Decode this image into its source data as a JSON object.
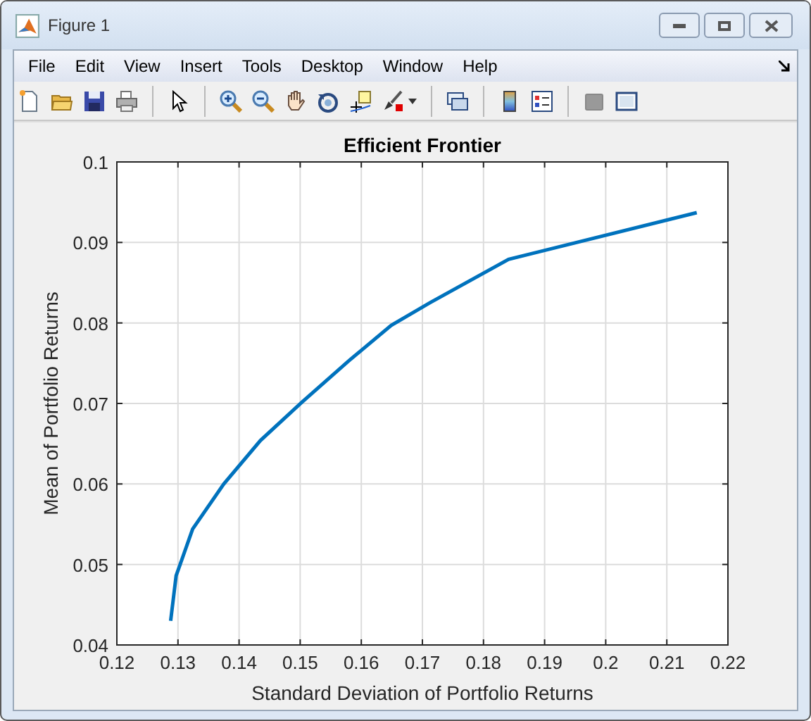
{
  "window": {
    "title": "Figure 1"
  },
  "menu": [
    "File",
    "Edit",
    "View",
    "Insert",
    "Tools",
    "Desktop",
    "Window",
    "Help"
  ],
  "toolbar": [
    {
      "kind": "new"
    },
    {
      "kind": "open"
    },
    {
      "kind": "save"
    },
    {
      "kind": "print"
    },
    {
      "kind": "sep"
    },
    {
      "kind": "pointer"
    },
    {
      "kind": "sep"
    },
    {
      "kind": "zoom-in"
    },
    {
      "kind": "zoom-out"
    },
    {
      "kind": "pan"
    },
    {
      "kind": "rotate"
    },
    {
      "kind": "datacursor"
    },
    {
      "kind": "brush"
    },
    {
      "kind": "sep"
    },
    {
      "kind": "link"
    },
    {
      "kind": "sep"
    },
    {
      "kind": "colorbar"
    },
    {
      "kind": "legend"
    },
    {
      "kind": "sep"
    },
    {
      "kind": "hide"
    },
    {
      "kind": "show"
    }
  ],
  "chart_data": {
    "type": "line",
    "title": "Efficient Frontier",
    "xlabel": "Standard Deviation of Portfolio Returns",
    "ylabel": "Mean of Portfolio Returns",
    "xlim": [
      0.12,
      0.22
    ],
    "ylim": [
      0.04,
      0.1
    ],
    "grid": true,
    "xticks": [
      0.12,
      0.13,
      0.14,
      0.15,
      0.16,
      0.17,
      0.18,
      0.19,
      0.2,
      0.21,
      0.22
    ],
    "yticks": [
      0.04,
      0.05,
      0.06,
      0.07,
      0.08,
      0.09,
      0.1
    ],
    "x": [
      0.1288,
      0.1297,
      0.1324,
      0.1375,
      0.1435,
      0.1502,
      0.1578,
      0.1649,
      0.1712,
      0.1841,
      0.2149
    ],
    "series": [
      {
        "color": "#0072bd",
        "values": [
          0.043,
          0.0486,
          0.0544,
          0.06,
          0.0654,
          0.0701,
          0.0752,
          0.0797,
          0.0825,
          0.0879,
          0.0937
        ]
      }
    ]
  }
}
